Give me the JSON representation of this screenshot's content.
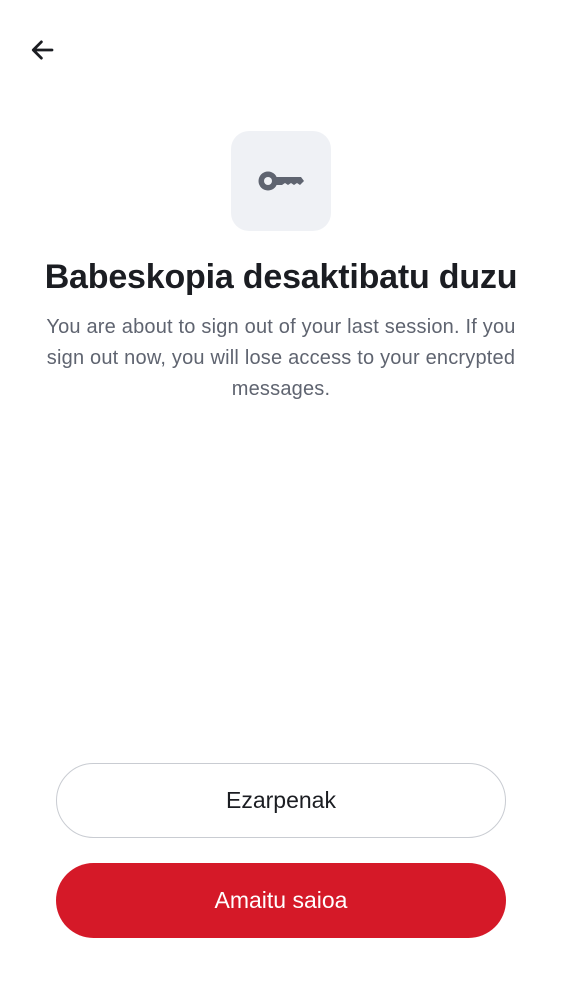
{
  "header": {
    "back_icon": "arrow-left-icon"
  },
  "hero": {
    "icon": "key-icon",
    "title": "Babeskopia desaktibatu duzu",
    "description": "You are about to sign out of your last session. If you sign out now, you will lose access to your encrypted messages."
  },
  "actions": {
    "settings_label": "Ezarpenak",
    "sign_out_label": "Amaitu saioa"
  },
  "colors": {
    "primary": "#d51928",
    "icon_tile": "#eff1f5",
    "title_text": "#1b1d22",
    "body_text": "#5f6470"
  }
}
